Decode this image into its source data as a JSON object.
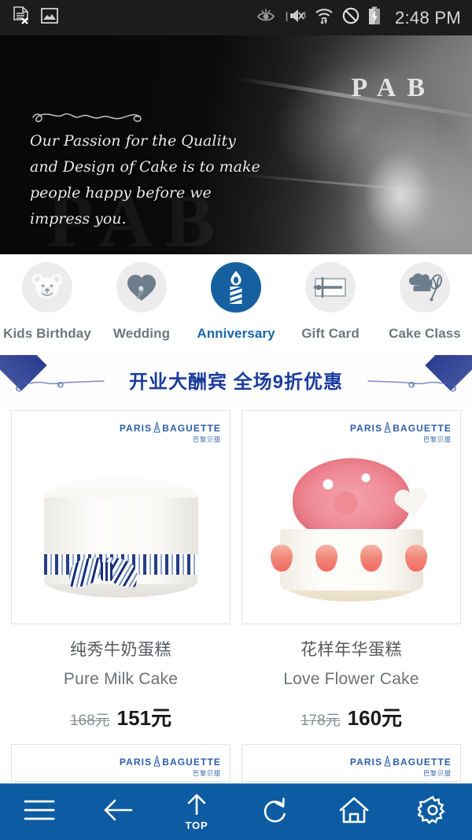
{
  "statusbar": {
    "time": "2:48 PM",
    "left_icons": [
      {
        "name": "file-error-icon",
        "label": "document with x"
      },
      {
        "name": "image-icon",
        "label": "picture"
      }
    ],
    "right_icons": [
      {
        "name": "eye-care-icon",
        "label": "eye"
      },
      {
        "name": "mute-icon",
        "label": "sound off"
      },
      {
        "name": "wifi-icon",
        "label": "wifi data"
      },
      {
        "name": "do-not-disturb-icon",
        "label": "no entry"
      },
      {
        "name": "battery-charging-icon",
        "label": "battery"
      }
    ]
  },
  "hero": {
    "quote": "Our Passion for the Quality and Design of Cake is to make people happy before we impress you.",
    "brand_mark": "PAB",
    "brand_watermark": "PAB"
  },
  "categories": [
    {
      "label": "Kids Birthday",
      "icon": "bear-icon",
      "active": false
    },
    {
      "label": "Wedding",
      "icon": "heart-icon",
      "active": false
    },
    {
      "label": "Anniversary",
      "icon": "candle-icon",
      "active": true
    },
    {
      "label": "Gift Card",
      "icon": "gift-card-icon",
      "active": false
    },
    {
      "label": "Cake Class",
      "icon": "chef-hat-whisk-icon",
      "active": false
    }
  ],
  "promo": {
    "text": "开业大酬宾 全场9折优惠"
  },
  "brand_logo": {
    "main": "PARIS",
    "main2": "BAGUETTE",
    "chinese": "巴黎贝甜"
  },
  "products": [
    {
      "name_cn": "纯秀牛奶蛋糕",
      "name_en": "Pure Milk Cake",
      "price_old": "168元",
      "price_new": "151元"
    },
    {
      "name_cn": "花样年华蛋糕",
      "name_en": "Love Flower Cake",
      "price_old": "178元",
      "price_new": "160元"
    }
  ],
  "bottom_nav": [
    {
      "name": "menu-icon",
      "label": "Menu"
    },
    {
      "name": "back-arrow-icon",
      "label": "Back"
    },
    {
      "name": "scroll-top-icon",
      "label": "TOP"
    },
    {
      "name": "refresh-icon",
      "label": "Refresh"
    },
    {
      "name": "home-icon",
      "label": "Home"
    },
    {
      "name": "settings-gear-icon",
      "label": "Settings"
    }
  ],
  "colors": {
    "brand_blue": "#0d5ba3",
    "accent_blue": "#2d8be0",
    "active_circle": "#16609f",
    "promo_text": "#1a3c9c",
    "inactive_icon": "#6e7880"
  }
}
